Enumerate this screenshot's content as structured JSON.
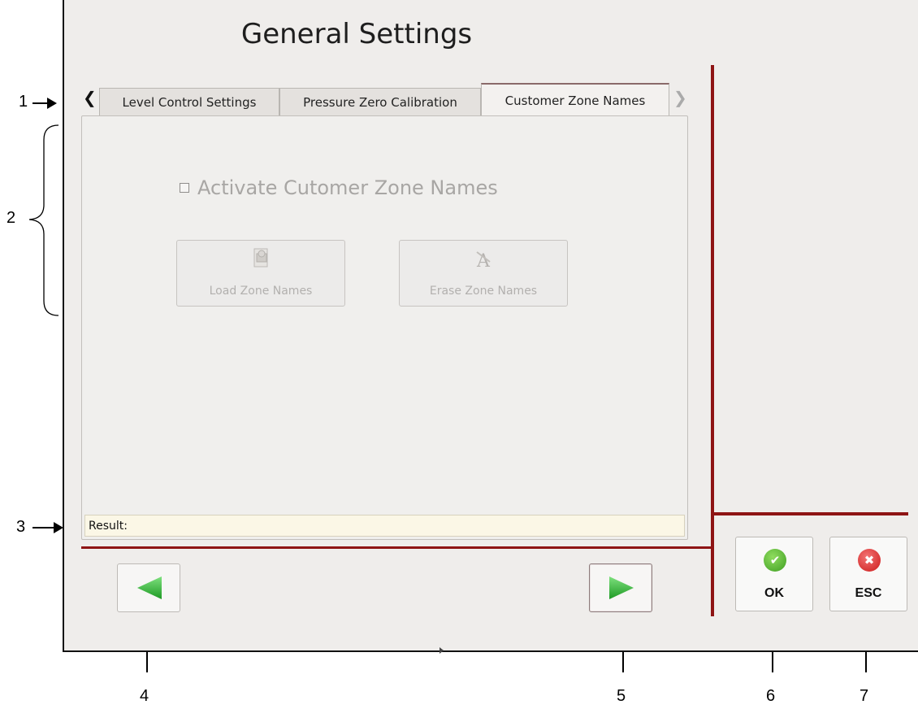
{
  "window": {
    "title": "General Settings"
  },
  "tabs": [
    {
      "label": "Level Control Settings",
      "active": false
    },
    {
      "label": "Pressure Zero Calibration",
      "active": false
    },
    {
      "label": "Customer Zone Names",
      "active": true
    }
  ],
  "panel": {
    "checkbox_label": "Activate Cutomer Zone Names",
    "checkbox_checked": false,
    "load_button_label": "Load Zone Names",
    "erase_button_label": "Erase Zone Names",
    "result_label": "Result:"
  },
  "actions": {
    "ok_label": "OK",
    "esc_label": "ESC"
  },
  "icons": {
    "prev": "green-left-arrow-icon",
    "next": "green-right-arrow-icon",
    "ok": "green-check-icon",
    "esc": "red-x-icon",
    "load": "floppy-file-icon",
    "erase": "erase-icon"
  },
  "colors": {
    "separator": "#8e1414",
    "arrow_green": "#3cb43c",
    "ok_green": "#4aa82e",
    "esc_red": "#d42424"
  },
  "callouts": {
    "c1": "1",
    "c2": "2",
    "c3": "3",
    "c4": "4",
    "c5": "5",
    "c6": "6",
    "c7": "7"
  }
}
